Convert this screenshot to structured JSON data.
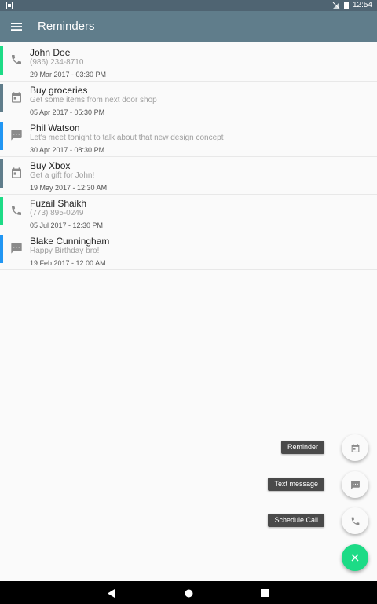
{
  "status_bar": {
    "time": "12:54"
  },
  "app_bar": {
    "title": "Reminders"
  },
  "colors": {
    "call": "#1ddb86",
    "task": "#607d8b",
    "message": "#2196f3"
  },
  "reminders": [
    {
      "type": "call",
      "icon": "phone-icon",
      "title": "John Doe",
      "subtitle": "(986) 234-8710",
      "date": "29 Mar 2017 - 03:30 PM"
    },
    {
      "type": "task",
      "icon": "calendar-icon",
      "title": "Buy groceries",
      "subtitle": "Get some items from next door shop",
      "date": "05 Apr 2017 - 05:30 PM"
    },
    {
      "type": "message",
      "icon": "message-icon",
      "title": "Phil Watson",
      "subtitle": "Let's meet tonight to talk about that new design concept",
      "date": "30 Apr 2017 - 08:30 PM"
    },
    {
      "type": "task",
      "icon": "calendar-icon",
      "title": "Buy Xbox",
      "subtitle": "Get a gift for John!",
      "date": "19 May 2017 - 12:30 AM"
    },
    {
      "type": "call",
      "icon": "phone-icon",
      "title": "Fuzail Shaikh",
      "subtitle": "(773) 895-0249",
      "date": "05 Jul 2017 - 12:30 PM"
    },
    {
      "type": "message",
      "icon": "message-icon",
      "title": "Blake Cunningham",
      "subtitle": "Happy Birthday bro!",
      "date": "19 Feb 2017 - 12:00 AM"
    }
  ],
  "fab_menu": {
    "reminder_label": "Reminder",
    "text_message_label": "Text message",
    "schedule_call_label": "Schedule Call",
    "close_icon": "close-icon"
  }
}
